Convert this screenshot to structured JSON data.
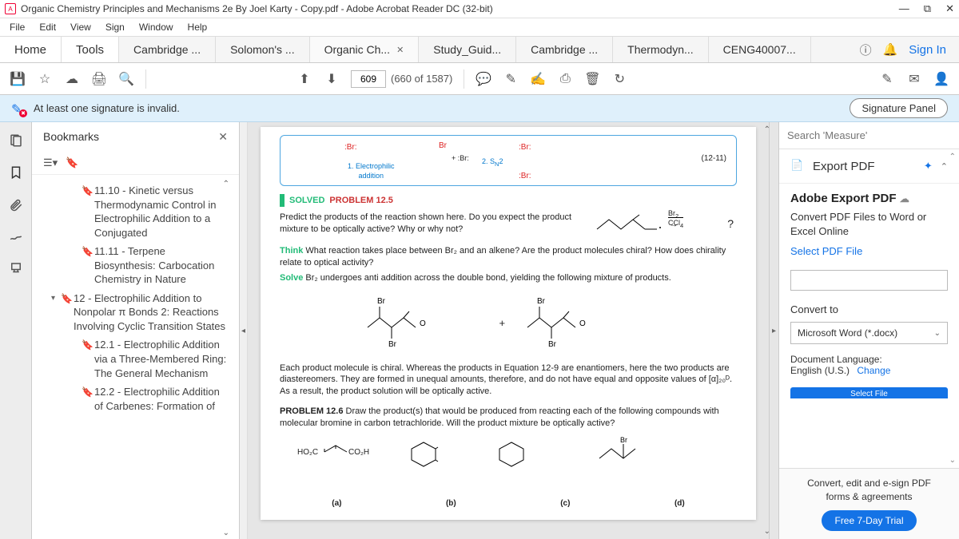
{
  "titlebar": {
    "title": "Organic Chemistry Principles and Mechanisms 2e By Joel Karty - Copy.pdf - Adobe Acrobat Reader DC (32-bit)"
  },
  "menubar": [
    "File",
    "Edit",
    "View",
    "Sign",
    "Window",
    "Help"
  ],
  "tabs": {
    "home": "Home",
    "tools": "Tools",
    "docs": [
      "Cambridge ...",
      "Solomon's ...",
      "Organic Ch...",
      "Study_Guid...",
      "Cambridge ...",
      "Thermodyn...",
      "CENG40007..."
    ],
    "active_index": 2,
    "signin": "Sign In"
  },
  "toolbar": {
    "page_current": "609",
    "page_total": "(660 of 1587)"
  },
  "sigbar": {
    "msg": "At least one signature is invalid.",
    "btn": "Signature Panel"
  },
  "bookmarks": {
    "title": "Bookmarks",
    "items": [
      {
        "lvl": 2,
        "text": "11.10 - Kinetic versus Thermodynamic Control in Electrophilic Addition to a Conjugated"
      },
      {
        "lvl": 2,
        "text": "11.11 - Terpene Biosynthesis: Carbocation Chemistry in Nature"
      },
      {
        "lvl": 1,
        "caret": "▾",
        "text": "12 - Electrophilic Addition to Nonpolar π Bonds 2: Reactions Involving Cyclic Transition States"
      },
      {
        "lvl": 2,
        "text": "12.1 - Electrophilic Addition via a Three-Membered Ring: The General Mechanism"
      },
      {
        "lvl": 2,
        "text": "12.2 - Electrophilic Addition of Carbenes: Formation of"
      }
    ]
  },
  "page": {
    "diag": {
      "lbl1a": "1. Electrophilic",
      "lbl1b": "addition",
      "lbl2": "2. S",
      "lbl2sub": "N",
      "lbl2c": "2",
      "br": ":Br:",
      "eqno": "(12-11)"
    },
    "solved": {
      "t1": "SOLVED",
      "t2": "PROBLEM 12.5"
    },
    "p1": "Predict the products of the reaction shown here. Do you expect the product mixture to be optically active? Why or why not?",
    "scheme": {
      "cond1": "Br",
      "cond1sub": "2",
      "cond2": "CCl",
      "cond2sub": "4",
      "q": "?"
    },
    "think_lbl": "Think",
    "think": " What reaction takes place between Br₂ and an alkene? Are the product molecules chiral? How does chirality relate to optical activity?",
    "solve_lbl": "Solve",
    "solve": " Br₂ undergoes anti addition across the double bond, yielding the following mixture of products.",
    "plus": "+",
    "p2": "Each product molecule is chiral. Whereas the products in Equation 12-9 are enantiomers, here the two products are diastereomers. They are formed in unequal amounts, therefore, and do not have equal and opposite values of [α]₂₀ᴰ. As a result, the product solution will be optically active.",
    "prob126_lbl": "PROBLEM 12.6",
    "prob126": " Draw the product(s) that would be produced from reacting each of the following compounds with molecular bromine in carbon tetrachloride. Will the product mixture be optically active?",
    "mol_a": "HO₂C",
    "mol_a2": "CO₂H",
    "abcd": [
      "(a)",
      "(b)",
      "(c)",
      "(d)"
    ]
  },
  "right": {
    "search_ph": "Search 'Measure'",
    "export_lbl": "Export PDF",
    "adobe_h": "Adobe Export PDF",
    "adobe_sub": "Convert PDF Files to Word or Excel Online",
    "select_file": "Select PDF File",
    "convert_to": "Convert to",
    "format": "Microsoft Word (*.docx)",
    "doclang_lbl": "Document Language:",
    "doclang": "English (U.S.)",
    "change": "Change",
    "select_btn_partial": "Select File",
    "footer_msg1": "Convert, edit and e-sign PDF",
    "footer_msg2": "forms & agreements",
    "trial": "Free 7-Day Trial"
  }
}
